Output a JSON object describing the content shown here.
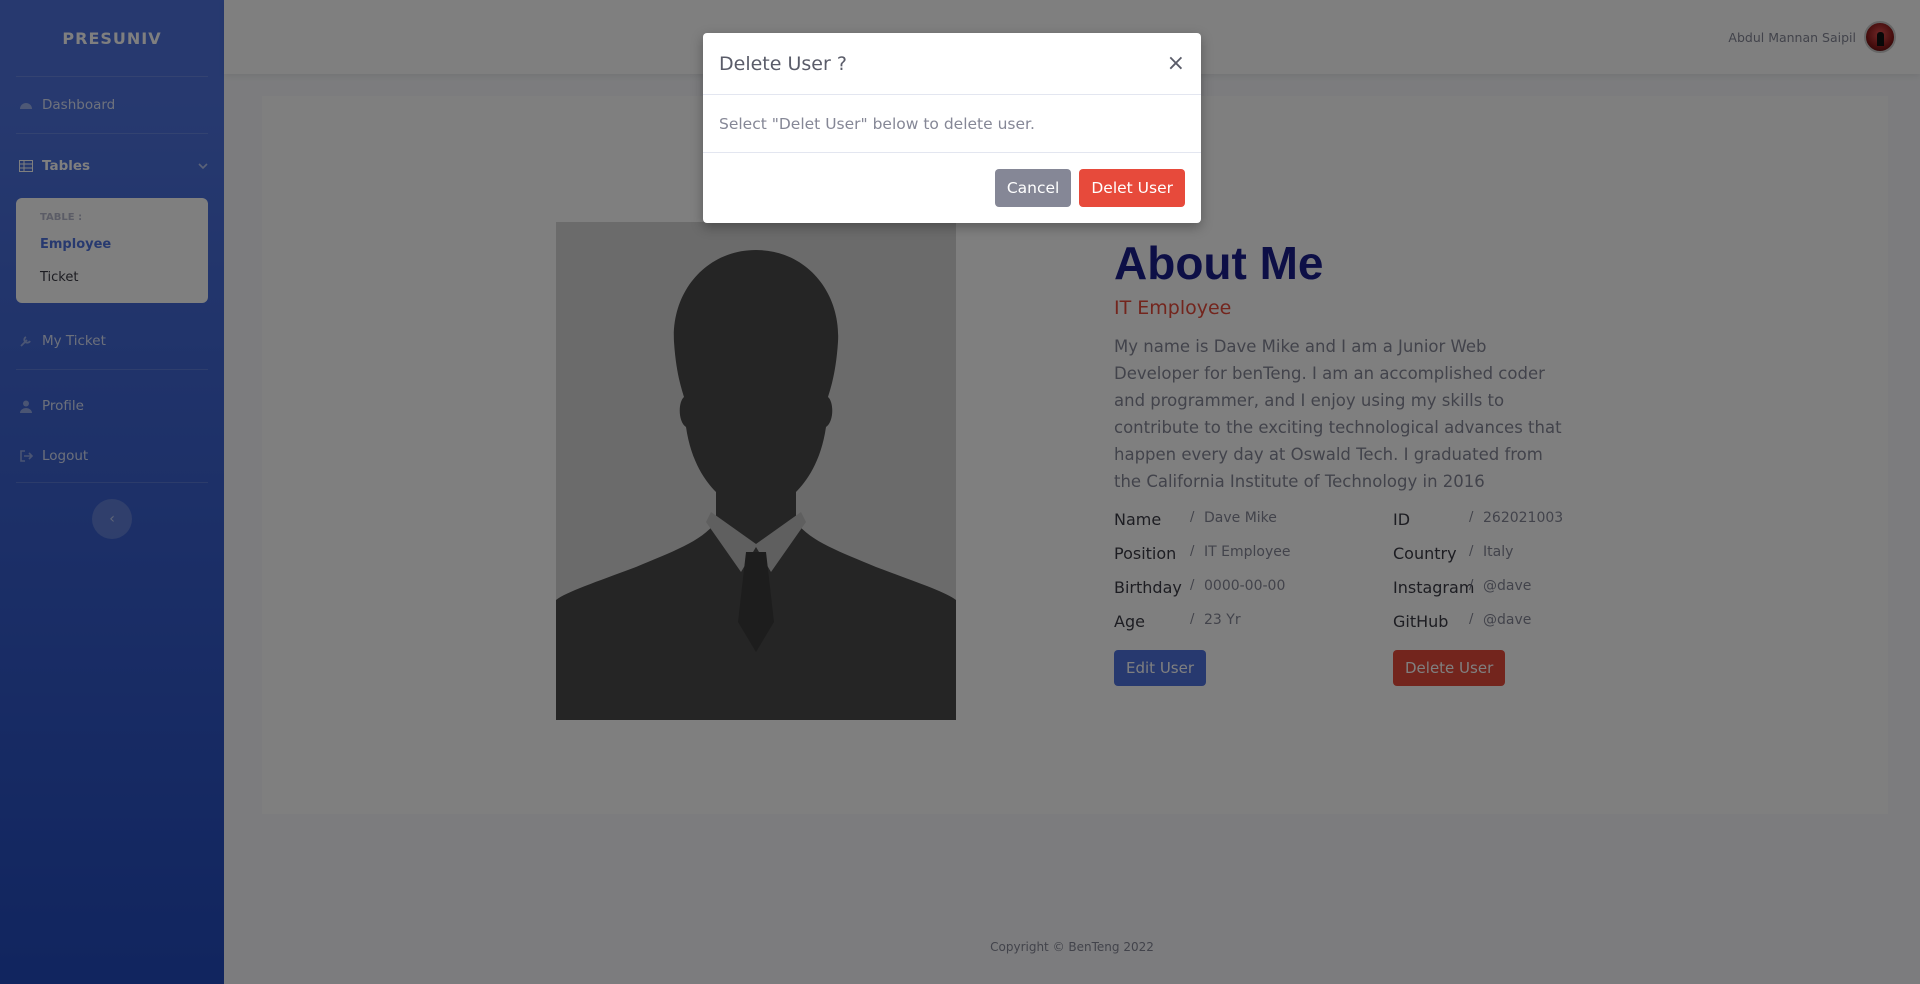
{
  "sidebar": {
    "brand": "PRESUNIV",
    "dashboard": "Dashboard",
    "tables": "Tables",
    "tables_header": "TABLE :",
    "tables_items": [
      "Employee",
      "Ticket"
    ],
    "my_ticket": "My Ticket",
    "profile": "Profile",
    "logout": "Logout",
    "toggle_glyph": "‹"
  },
  "topbar": {
    "user_name": "Abdul Mannan Saipil"
  },
  "profile": {
    "heading": "About Me",
    "role": "IT Employee",
    "bio": "My name is Dave Mike and I am a Junior Web Developer for benTeng. I am an accomplished coder and programmer, and I enjoy using my skills to contribute to the exciting technological advances that happen every day at Oswald Tech. I graduated from the California Institute of Technology in 2016",
    "details_left": [
      {
        "label": "Name",
        "value": "Dave Mike"
      },
      {
        "label": "Position",
        "value": "IT Employee"
      },
      {
        "label": "Birthday",
        "value": "0000-00-00"
      },
      {
        "label": "Age",
        "value": "23 Yr"
      }
    ],
    "details_right": [
      {
        "label": "ID",
        "value": "262021003"
      },
      {
        "label": "Country",
        "value": "Italy"
      },
      {
        "label": "Instagram",
        "value": "@dave"
      },
      {
        "label": "GitHub",
        "value": "@dave"
      }
    ],
    "separator": "/",
    "edit_button": "Edit User",
    "delete_button": "Delete User"
  },
  "footer": {
    "copyright": "Copyright © BenTeng 2022"
  },
  "modal": {
    "title": "Delete User ?",
    "close": "×",
    "body": "Select \"Delet User\" below to delete user.",
    "cancel": "Cancel",
    "confirm": "Delet User"
  },
  "colors": {
    "sidebar_gradient_start": "#4e73df",
    "sidebar_gradient_end": "#224abe",
    "primary": "#4e73df",
    "danger": "#e74a3b",
    "secondary": "#858796",
    "heading": "#1b1f8c"
  },
  "icons": {
    "dashboard": "tachometer-icon",
    "tables": "table-icon",
    "my_ticket": "wrench-icon",
    "profile": "user-icon",
    "logout": "sign-out-icon"
  }
}
